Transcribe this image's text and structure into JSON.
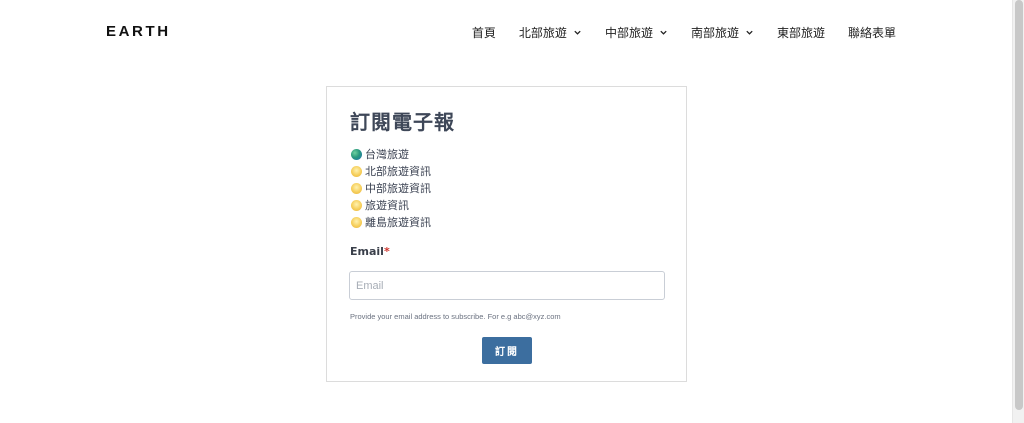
{
  "header": {
    "logo": "EARTH",
    "nav": [
      {
        "label": "首頁",
        "dropdown": false
      },
      {
        "label": "北部旅遊",
        "dropdown": true
      },
      {
        "label": "中部旅遊",
        "dropdown": true
      },
      {
        "label": "南部旅遊",
        "dropdown": true
      },
      {
        "label": "東部旅遊",
        "dropdown": false
      },
      {
        "label": "聯絡表單",
        "dropdown": false
      }
    ]
  },
  "form": {
    "title": "訂閱電子報",
    "lists": [
      {
        "label": "台灣旅遊",
        "icon": "globe-icon"
      },
      {
        "label": "北部旅遊資訊",
        "icon": "sun-icon"
      },
      {
        "label": "中部旅遊資訊",
        "icon": "sun-icon"
      },
      {
        "label": "旅遊資訊",
        "icon": "sun-icon"
      },
      {
        "label": "離島旅遊資訊",
        "icon": "sun-icon"
      }
    ],
    "email_label": "Email",
    "required_mark": "*",
    "email_placeholder": "Email",
    "email_value": "",
    "help_text": "Provide your email address to subscribe. For e.g abc@xyz.com",
    "submit_label": "訂閱"
  },
  "colors": {
    "button": "#3c6e9f",
    "title": "#3e4758",
    "required": "#d0342c"
  }
}
